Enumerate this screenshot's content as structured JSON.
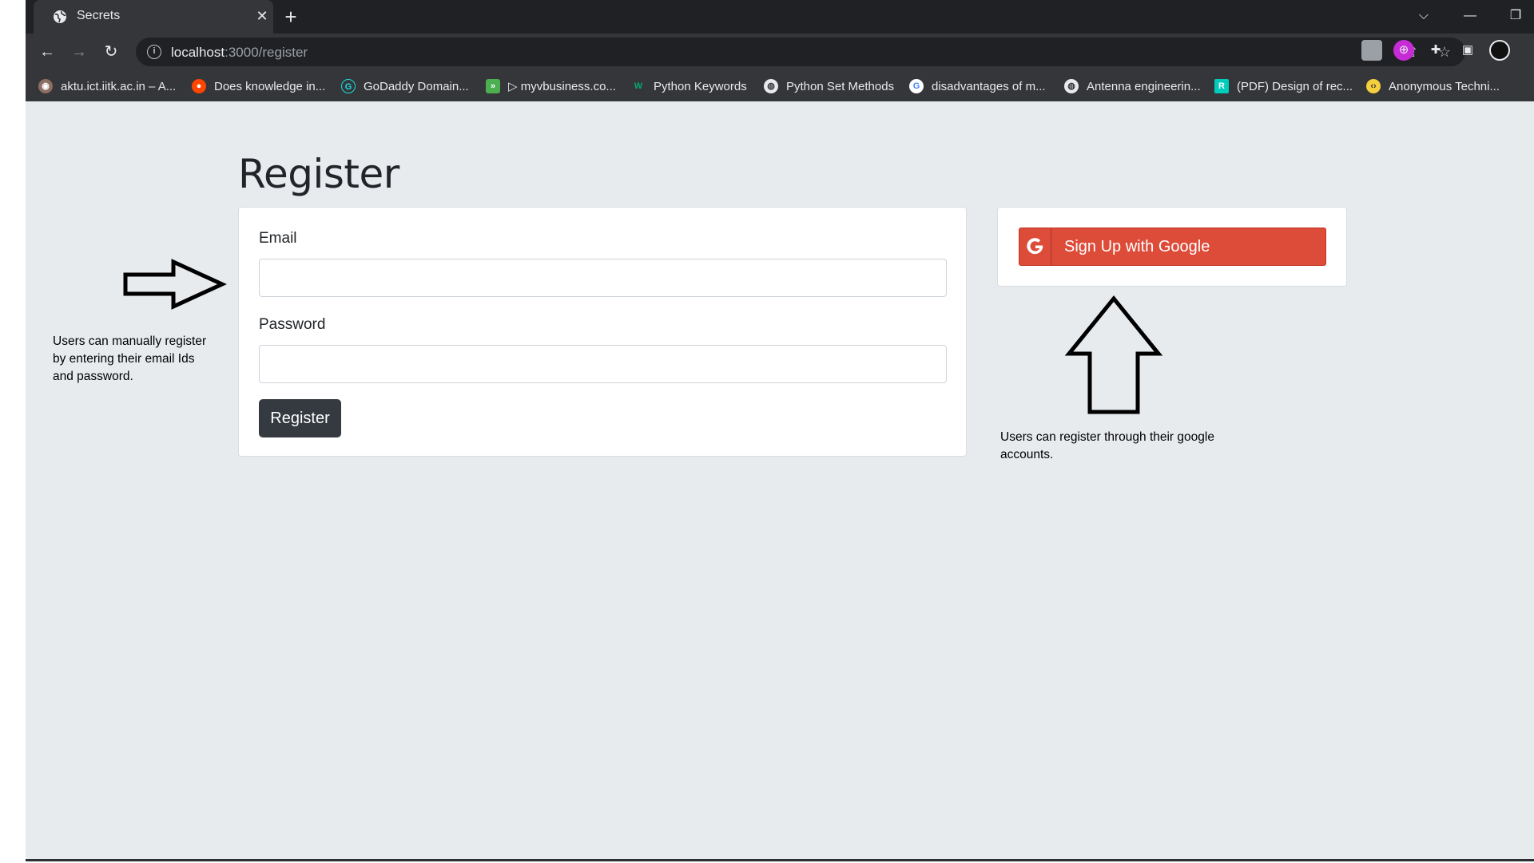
{
  "browser": {
    "tab": {
      "title": "Secrets",
      "favicon": "globe-icon"
    },
    "window_controls": {
      "dropdown": "chevron-down-icon",
      "minimize": "minimize-icon",
      "restore": "restore-icon",
      "close": "close-icon"
    },
    "address_bar": {
      "host": "localhost",
      "path": ":3000/register"
    },
    "bookmarks": [
      {
        "label": "aktu.ict.iitk.ac.in – A...",
        "icon": "aktu-icon",
        "color": "#8d6e63"
      },
      {
        "label": "Does knowledge in...",
        "icon": "reddit-icon",
        "color": "#ff4500"
      },
      {
        "label": "GoDaddy Domain...",
        "icon": "godaddy-icon",
        "color": "#1bdbdb"
      },
      {
        "label": "▷ myvbusiness.co...",
        "icon": "myv-icon",
        "color": "#4caf50"
      },
      {
        "label": "Python Keywords",
        "icon": "w3-icon",
        "color": "#04aa6d"
      },
      {
        "label": "Python Set Methods",
        "icon": "globe-icon",
        "color": "#5f6368"
      },
      {
        "label": "disadvantages of m...",
        "icon": "google-icon",
        "color": "#ffffff"
      },
      {
        "label": "Antenna engineerin...",
        "icon": "globe-icon",
        "color": "#5f6368"
      },
      {
        "label": "(PDF) Design of rec...",
        "icon": "researchgate-icon",
        "color": "#00ccbb"
      },
      {
        "label": "Anonymous Techni...",
        "icon": "anon-icon",
        "color": "#f4d03f"
      }
    ]
  },
  "page": {
    "title": "Register",
    "form": {
      "email_label": "Email",
      "email_value": "",
      "password_label": "Password",
      "password_value": "",
      "submit_label": "Register"
    },
    "social": {
      "google_label": "Sign Up with Google",
      "google_color": "#dd4b39"
    },
    "annotations": {
      "left": [
        "Users can manually register",
        "by entering their email Ids",
        "and password."
      ],
      "right": [
        "Users can register through their google",
        "accounts."
      ]
    }
  }
}
